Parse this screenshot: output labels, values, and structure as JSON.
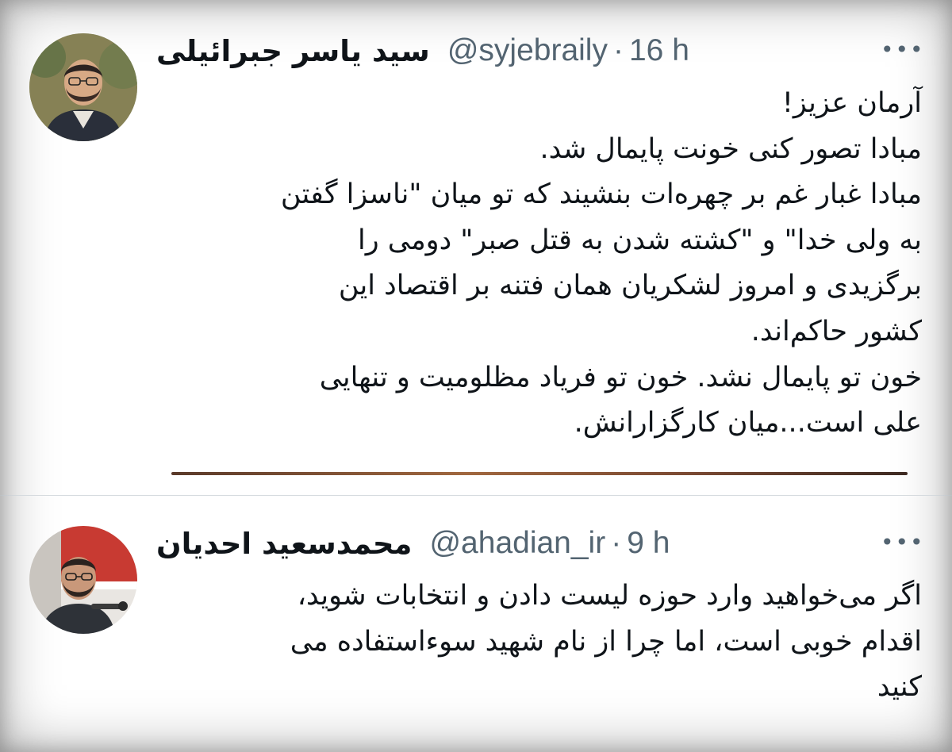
{
  "tweets": [
    {
      "display_name": "سید یاسر جبرائیلی",
      "handle": "@syjebraily",
      "separator": "·",
      "time": "16 h",
      "more_icon": "more-dots-icon",
      "lines": [
        "آرمان عزیز!",
        "مبادا تصور کنی خونت پایمال شد.",
        "مبادا غبار غم بر چهره‌ات بنشیند که تو میان \"ناسزا گفتن",
        "به ولی خدا\" و \"کشته شدن به قتل صبر\" دومی را",
        "برگزیدی و امروز لشکریان همان فتنه بر اقتصاد این",
        "کشور حاکم‌اند.",
        "خون تو پایمال نشد. خون تو فریاد مظلومیت و تنهایی",
        "علی است...میان کارگزارانش."
      ]
    },
    {
      "display_name": "محمدسعید احدیان",
      "handle": "@ahadian_ir",
      "separator": "·",
      "time": "9 h",
      "more_icon": "more-dots-icon",
      "lines": [
        "اگر می‌خواهید وارد  حوزه لیست دادن و انتخابات شوید،",
        "اقدام خوبی است، اما چرا از نام شهید سوءاستفاده می",
        "کنید"
      ]
    }
  ],
  "colors": {
    "text_primary": "#0f1419",
    "text_secondary": "#536471",
    "divider": "#d5dade",
    "background": "#ffffff"
  }
}
